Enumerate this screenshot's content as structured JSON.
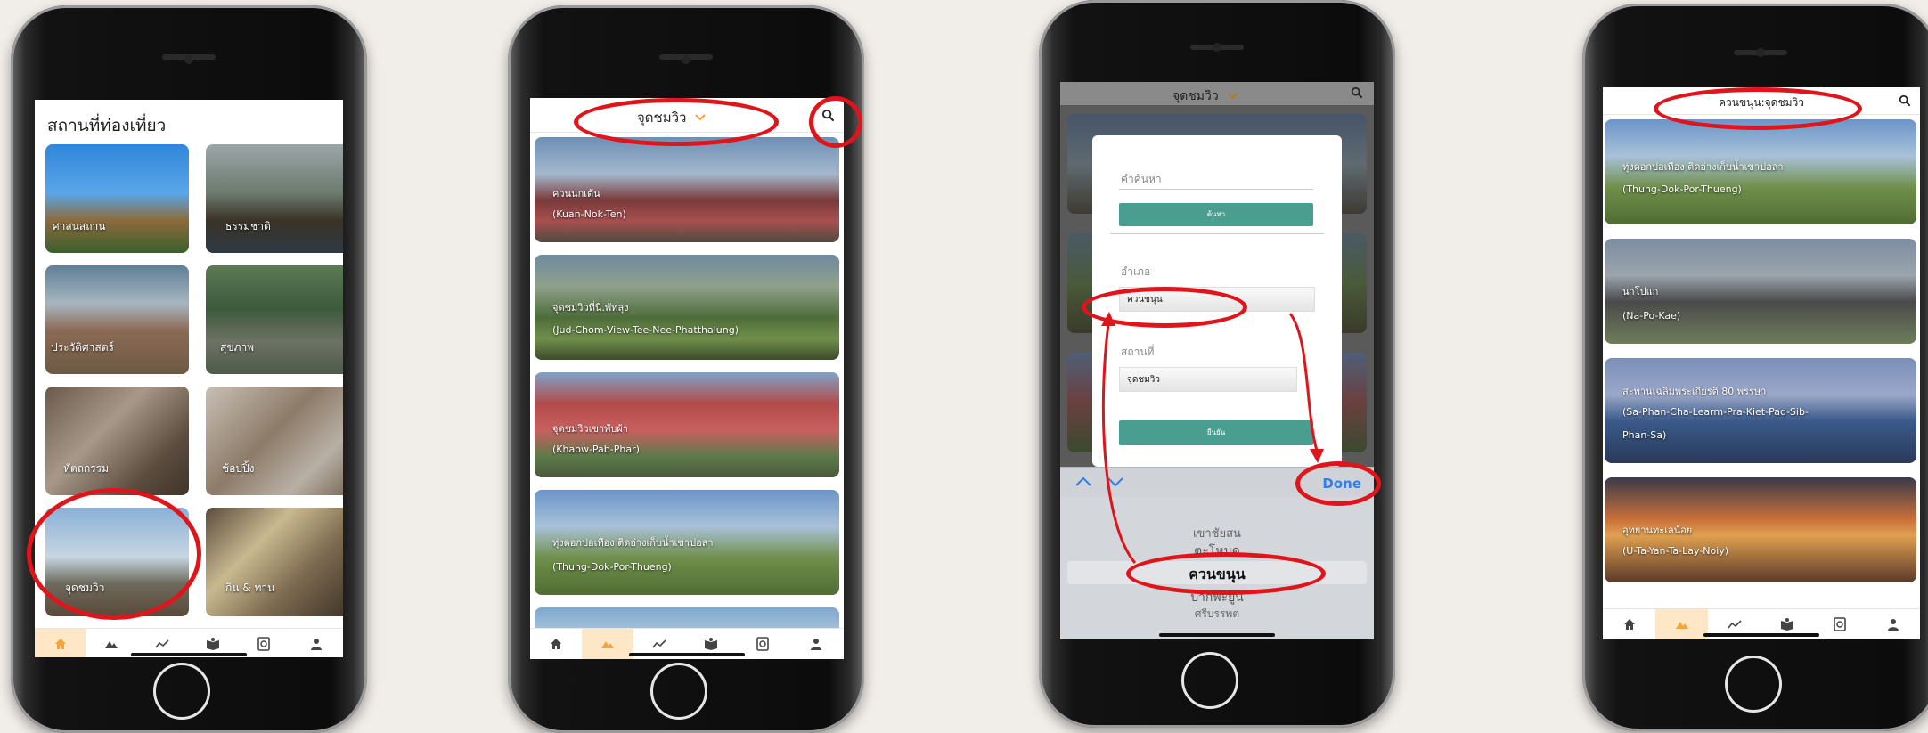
{
  "colors": {
    "accent": "#f5a33b",
    "tab_active_bg": "#fde7c6",
    "teal": "#4a9e8f",
    "annotation": "#e0141b",
    "done_blue": "#2f80ed"
  },
  "screen1": {
    "title": "สถานที่ท่องเที่ยว",
    "categories": [
      {
        "label": "ศาสนสถาน"
      },
      {
        "label": "ธรรมชาติ"
      },
      {
        "label": "ประวัติศาสตร์"
      },
      {
        "label": "สุขภาพ"
      },
      {
        "label": "หัตถกรรม"
      },
      {
        "label": "ช้อปปิ้ง"
      },
      {
        "label": "จุดชมวิว"
      },
      {
        "label": "กิน & ทาน"
      }
    ]
  },
  "screen2": {
    "header": "จุดชมวิว",
    "places": [
      {
        "th": "ควนนกเต้น",
        "en": "(Kuan-Nok-Ten)"
      },
      {
        "th": "จุดชมวิวที่นี่.พัทลุง",
        "en": "(Jud-Chom-View-Tee-Nee-Phatthalung)"
      },
      {
        "th": "จุดชมวิวเขาพับผ้า",
        "en": "(Khaow-Pab-Phar)"
      },
      {
        "th": "ทุ่งดอกปอเทือง ติดอ่างเก็บน้ำเขาปอลา",
        "en": "(Thung-Dok-Por-Thueng)"
      }
    ]
  },
  "screen3": {
    "header": "จุดชมวิว",
    "search_label": "คำค้นหา",
    "search_button": "ค้นหา",
    "district_label": "อำเภอ",
    "district_value": "ควนขนุน",
    "place_label": "สถานที่",
    "place_value": "จุดชมวิว",
    "confirm_button": "ยืนยัน",
    "done": "Done",
    "picker": [
      "เขาชัยสน",
      "ตะโหมด",
      "ควนขนุน",
      "ปากพะยูน",
      "ศรีบรรพต"
    ]
  },
  "screen4": {
    "header": "ควนขนุน:จุดชมวิว",
    "places": [
      {
        "th": "ทุ่งดอกปอเทือง ติดอ่างเก็บน้ำเขาปอลา",
        "en": "(Thung-Dok-Por-Thueng)"
      },
      {
        "th": "นาโปแก",
        "en": "(Na-Po-Kae)"
      },
      {
        "th": "สะพานเฉลิมพระเกียรติ 80 พรรษา",
        "en": "(Sa-Phan-Cha-Learm-Pra-Kiet-Pad-Sib-",
        "en2": "Phan-Sa)"
      },
      {
        "th": "อุทยานทะเลน้อย",
        "en": "(U-Ta-Yan-Ta-Lay-Noiy)"
      }
    ]
  },
  "tabs": [
    {
      "icon": "home-icon"
    },
    {
      "icon": "mountain-icon"
    },
    {
      "icon": "trend-icon"
    },
    {
      "icon": "book-icon"
    },
    {
      "icon": "search-doc-icon"
    },
    {
      "icon": "user-icon"
    }
  ]
}
